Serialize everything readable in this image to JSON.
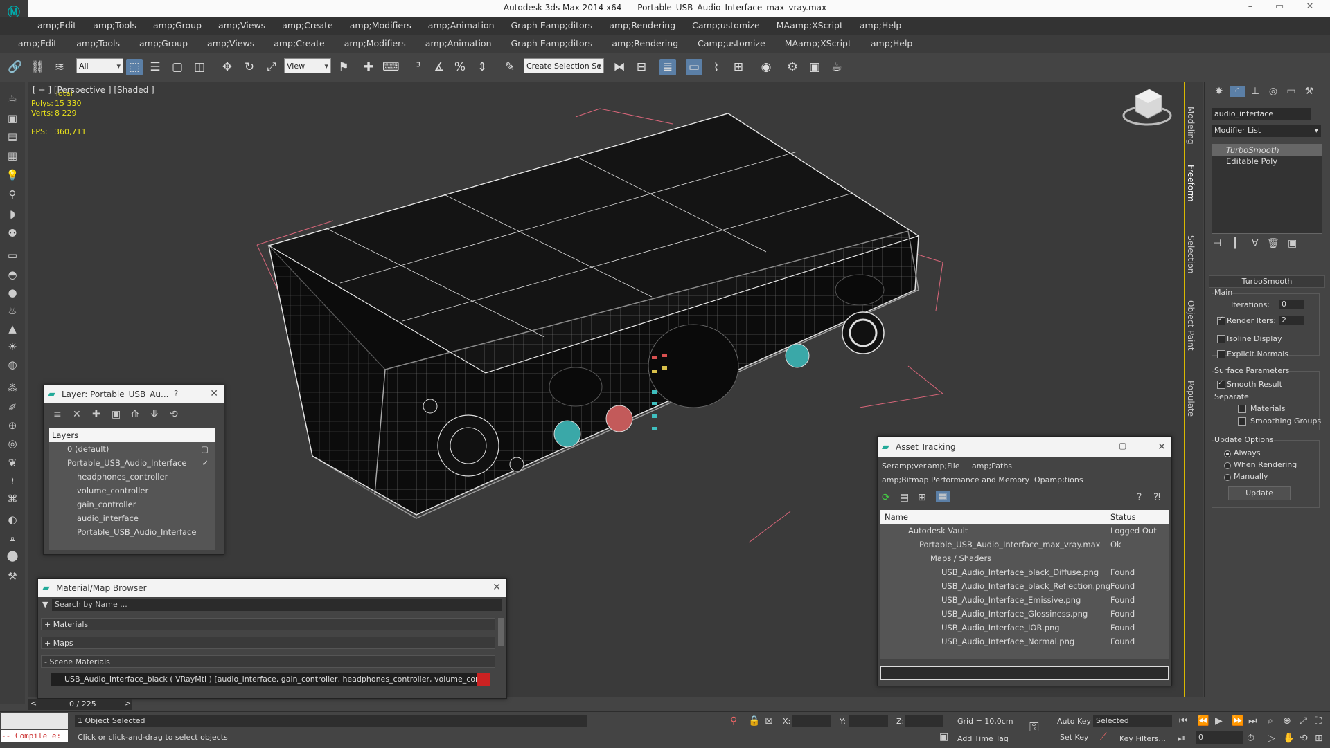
{
  "window": {
    "app_title": "Autodesk 3ds Max  2014 x64",
    "file_title": "Portable_USB_Audio_Interface_max_vray.max",
    "min": "–",
    "max": "▭",
    "close": "✕"
  },
  "menu1": [
    "amp;Edit",
    "amp;Tools",
    "amp;Group",
    "amp;Views",
    "amp;Create",
    "amp;Modifiers",
    "amp;Animation",
    "Graph Eamp;ditors",
    "amp;Rendering",
    "Camp;ustomize",
    "MAamp;XScript",
    "amp;Help"
  ],
  "menu2": [
    "amp;Edit",
    "amp;Tools",
    "amp;Group",
    "amp;Views",
    "amp;Create",
    "amp;Modifiers",
    "amp;Animation",
    "Graph Eamp;ditors",
    "amp;Rendering",
    "Camp;ustomize",
    "MAamp;XScript",
    "amp;Help"
  ],
  "toolbar": {
    "filter_value": "All",
    "refcoord_value": "View",
    "selection_set_placeholder": "Create Selection Se"
  },
  "viewport": {
    "label": "[ + ] [Perspective ] [Shaded ]",
    "stats": {
      "total_label": "Total",
      "polys_label": "Polys:",
      "polys_value": "15 330",
      "verts_label": "Verts:",
      "verts_value": "8 229",
      "fps_label": "FPS:",
      "fps_value": "360,711"
    }
  },
  "ribbon_tabs": [
    "Modeling",
    "Freeform",
    "Selection",
    "Object Paint",
    "Populate"
  ],
  "command_panel": {
    "object_name": "audio_interface",
    "modifier_list": "Modifier List",
    "stack": [
      "TurboSmooth",
      "Editable Poly"
    ],
    "rollout_title": "TurboSmooth",
    "main_label": "Main",
    "iterations_label": "Iterations:",
    "iterations_value": "0",
    "render_iters_label": "Render Iters:",
    "render_iters_value": "2",
    "isoline_label": "Isoline Display",
    "explicit_label": "Explicit Normals",
    "surface_label": "Surface Parameters",
    "smooth_label": "Smooth Result",
    "separate_label": "Separate",
    "materials_label": "Materials",
    "smoothing_label": "Smoothing Groups",
    "update_options_label": "Update Options",
    "always_label": "Always",
    "when_rendering_label": "When Rendering",
    "manually_label": "Manually",
    "update_button": "Update"
  },
  "layer_window": {
    "title": "Layer: Portable_USB_Au...",
    "help": "?",
    "header": "Layers",
    "rows": [
      {
        "name": "0 (default)",
        "indent": 0
      },
      {
        "name": "Portable_USB_Audio_Interface",
        "indent": 0
      },
      {
        "name": "headphones_controller",
        "indent": 1
      },
      {
        "name": "volume_controller",
        "indent": 1
      },
      {
        "name": "gain_controller",
        "indent": 1
      },
      {
        "name": "audio_interface",
        "indent": 1
      },
      {
        "name": "Portable_USB_Audio_Interface",
        "indent": 1
      }
    ]
  },
  "material_browser": {
    "title": "Material/Map Browser",
    "search_placeholder": "Search by Name ...",
    "sections": [
      "+ Materials",
      "+ Maps",
      "- Scene Materials"
    ],
    "scene_material": "USB_Audio_Interface_black ( VRayMtl ) [audio_interface, gain_controller, headphones_controller, volume_controller]"
  },
  "asset_tracking": {
    "title": "Asset Tracking",
    "menu1": [
      "Seramp;ver",
      "amp;File",
      "amp;Paths"
    ],
    "menu2": [
      "amp;Bitmap Performance and Memory",
      "Opamp;tions"
    ],
    "col_name": "Name",
    "col_status": "Status",
    "rows": [
      {
        "name": "Autodesk Vault",
        "status": "Logged Out",
        "indent": 1
      },
      {
        "name": "Portable_USB_Audio_Interface_max_vray.max",
        "status": "Ok",
        "indent": 2
      },
      {
        "name": "Maps / Shaders",
        "status": "",
        "indent": 3
      },
      {
        "name": "USB_Audio_Interface_black_Diffuse.png",
        "status": "Found",
        "indent": 4
      },
      {
        "name": "USB_Audio_Interface_black_Reflection.png",
        "status": "Found",
        "indent": 4
      },
      {
        "name": "USB_Audio_Interface_Emissive.png",
        "status": "Found",
        "indent": 4
      },
      {
        "name": "USB_Audio_Interface_Glossiness.png",
        "status": "Found",
        "indent": 4
      },
      {
        "name": "USB_Audio_Interface_IOR.png",
        "status": "Found",
        "indent": 4
      },
      {
        "name": "USB_Audio_Interface_Normal.png",
        "status": "Found",
        "indent": 4
      }
    ]
  },
  "timeline": {
    "frame": "0 / 225",
    "prev": "<",
    "next": ">"
  },
  "status": {
    "script_label": "-- Compile e:",
    "objects_selected": "1 Object Selected",
    "prompt": "Click or click-and-drag to select objects",
    "x_label": "X:",
    "y_label": "Y:",
    "z_label": "Z:",
    "grid": "Grid = 10,0cm",
    "add_time_tag": "Add Time Tag",
    "auto_key": "Auto Key",
    "set_key": "Set Key",
    "selected_value": "Selected",
    "key_filters": "Key Filters...",
    "frame_value": "0"
  },
  "colors": {
    "accent": "#5b7fa6",
    "viewport_border": "#d8b800",
    "stats": "#e8e01c",
    "script_red": "#c33"
  }
}
